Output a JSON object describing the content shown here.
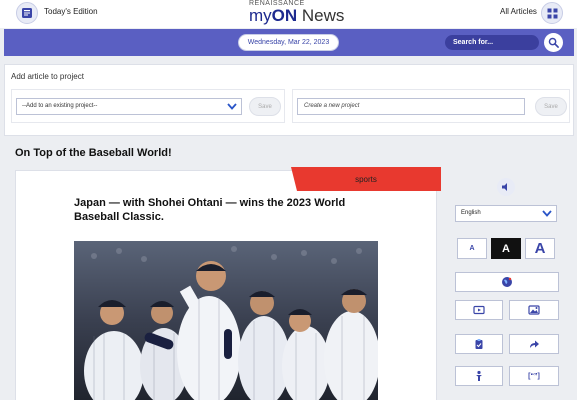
{
  "header": {
    "edition_label": "Today's Edition",
    "brand_top": "RENAISSANCE",
    "brand_my": "my",
    "brand_on": "ON",
    "brand_news": " News",
    "all_articles_label": "All Articles"
  },
  "nav": {
    "date": "Wednesday, Mar 22, 2023",
    "search_placeholder": "Search for..."
  },
  "project": {
    "title": "Add article to project",
    "existing_select_value": "--Add to an existing project--",
    "save_label": "Save",
    "new_project_placeholder": "Create a new project",
    "save_label_2": "Save"
  },
  "article": {
    "heading": "On Top of the Baseball World!",
    "category": "sports",
    "subheading": "Japan — with Shohei Ohtani — wins the 2023 World Baseball Classic."
  },
  "sidebar": {
    "language": "English",
    "font_small": "A",
    "font_medium": "A",
    "font_large": "A",
    "cite_label": "[“”]"
  },
  "colors": {
    "brand_blue": "#1e2a8f",
    "nav_purple": "#5a5fc2",
    "category_red": "#e8392f"
  },
  "icons": {
    "edition": "newspaper-icon",
    "all_articles": "grid-icon",
    "search": "search-icon",
    "speaker": "speaker-icon",
    "translate": "globe-icon",
    "video": "video-icon",
    "image": "image-icon",
    "note": "clipboard-icon",
    "share": "share-arrow-icon",
    "accessibility": "person-icon"
  }
}
